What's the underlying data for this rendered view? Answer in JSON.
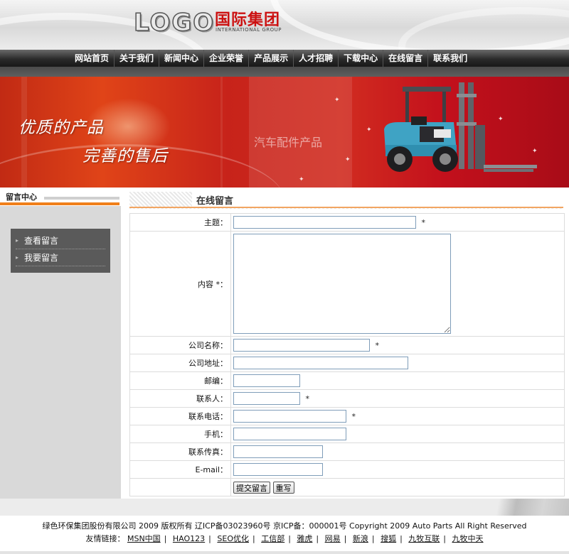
{
  "header": {
    "logo_word": "LOGO",
    "logo_cn": "国际集团",
    "logo_en": "INTERNATIONAL GROUP"
  },
  "nav": {
    "items": [
      "网站首页",
      "关于我们",
      "新闻中心",
      "企业荣誉",
      "产品展示",
      "人才招聘",
      "下载中心",
      "在线留言",
      "联系我们"
    ]
  },
  "banner": {
    "slogan_line1": "优质的产品",
    "slogan_line2": "完善的售后",
    "product_text": "汽车配件产品"
  },
  "sidebar": {
    "title": "留言中心",
    "items": [
      "查看留言",
      "我要留言"
    ]
  },
  "main": {
    "title": "在线留言"
  },
  "form": {
    "subject_label": "主题：",
    "subject_value": "",
    "content_label": "内容 *：",
    "content_value": "",
    "company_label": "公司名称：",
    "company_value": "",
    "address_label": "公司地址：",
    "address_value": "",
    "zip_label": "邮编：",
    "zip_value": "",
    "contact_label": "联系人：",
    "contact_value": "",
    "phone_label": "联系电话：",
    "phone_value": "",
    "mobile_label": "手机：",
    "mobile_value": "",
    "fax_label": "联系传真：",
    "fax_value": "",
    "email_label": "E-mail：",
    "email_value": "",
    "required_mark": "*",
    "submit_label": "提交留言",
    "reset_label": "重写"
  },
  "footer": {
    "copyright": "绿色环保集团股份有限公司 2009 版权所有 辽ICP备03023960号 京ICP备：000001号 Copyright 2009 Auto Parts All Right Reserved",
    "links_label": "友情链接：",
    "links": [
      "MSN中国",
      "HAO123",
      "SEO优化",
      "工信部",
      "雅虎",
      "网易",
      "新浪",
      "搜狐",
      "九牧互联",
      "九牧中天"
    ],
    "separator": "|"
  }
}
